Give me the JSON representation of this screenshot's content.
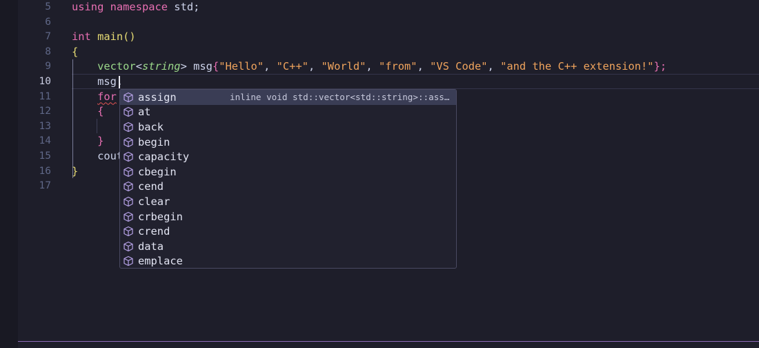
{
  "gutter": {
    "line_numbers": [
      "5",
      "6",
      "7",
      "8",
      "9",
      "10",
      "11",
      "12",
      "13",
      "14",
      "15",
      "16",
      "17"
    ],
    "active_line": "10"
  },
  "code": {
    "line5": {
      "kw1": "using",
      "kw2": "namespace",
      "rest": " std;"
    },
    "line7": {
      "kw": "int",
      "fn": " main()"
    },
    "line8": {
      "brace": "{"
    },
    "line9": {
      "type": "vector",
      "lt": "<",
      "targ": "string",
      "gt": ">",
      "name": " msg",
      "open": "{",
      "s1": "\"Hello\"",
      "s2": "\"C++\"",
      "s3": "\"World\"",
      "s4": "\"from\"",
      "s5": "\"VS Code\"",
      "s6": "\"and the C++ extension!\"",
      "sep": ", ",
      "close": "};"
    },
    "line10": {
      "text": "msg."
    },
    "line11": {
      "kw": "for"
    },
    "line12": {
      "brace": "{"
    },
    "line14": {
      "brace": "}"
    },
    "line15": {
      "text": "cout"
    },
    "line16": {
      "brace": "}"
    }
  },
  "suggest": {
    "icon": "cube-icon",
    "items": [
      {
        "label": "assign",
        "detail": "inline void std::vector<std::string>::ass…",
        "selected": true
      },
      {
        "label": "at"
      },
      {
        "label": "back"
      },
      {
        "label": "begin"
      },
      {
        "label": "capacity"
      },
      {
        "label": "cbegin"
      },
      {
        "label": "cend"
      },
      {
        "label": "clear"
      },
      {
        "label": "crbegin"
      },
      {
        "label": "crend"
      },
      {
        "label": "data"
      },
      {
        "label": "emplace"
      }
    ]
  },
  "colors": {
    "background": "#1e1e2a",
    "keyword": "#e76fb2",
    "string": "#f0a45d",
    "type": "#9bd88a",
    "icon": "#b7a3e8"
  }
}
